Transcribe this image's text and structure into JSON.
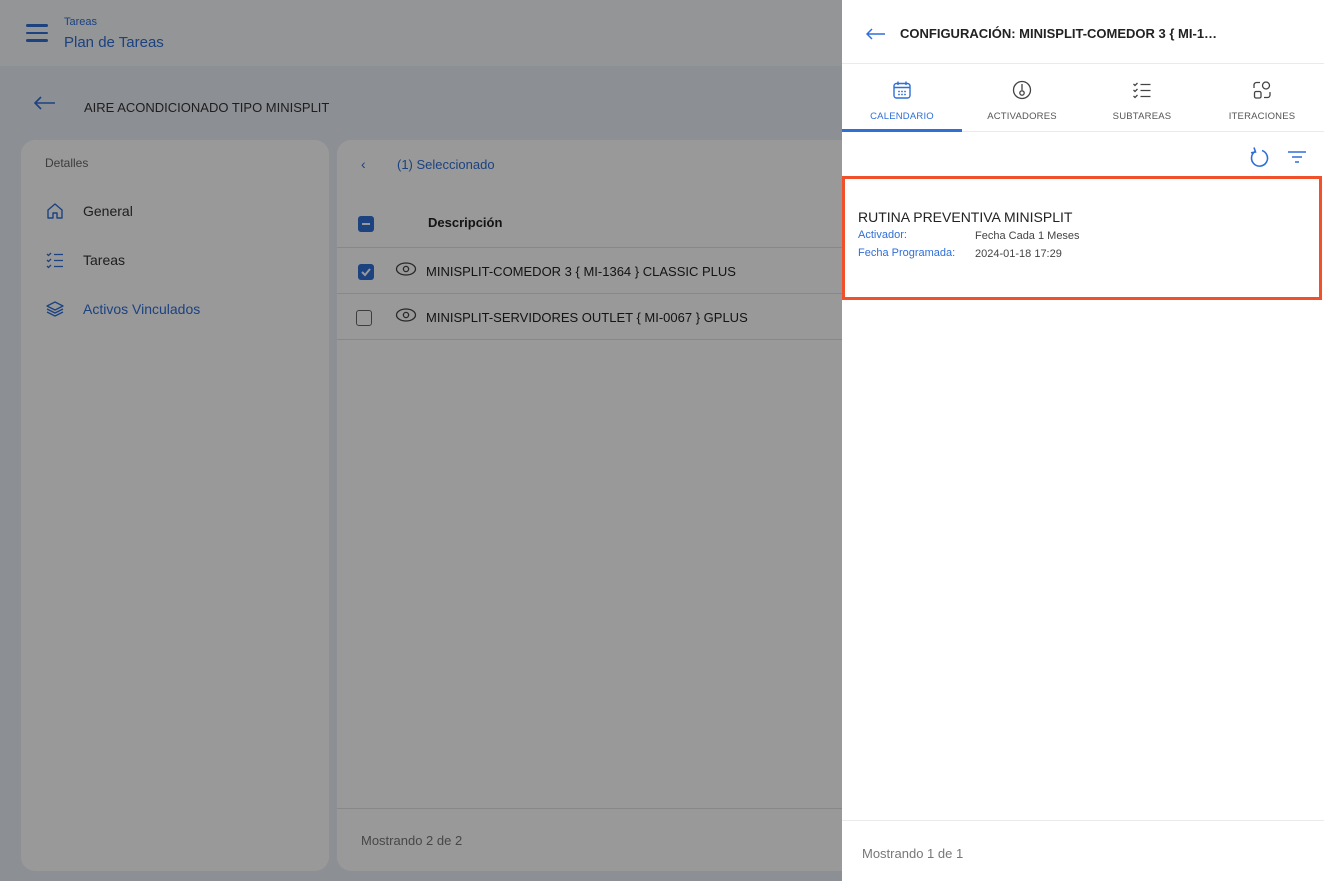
{
  "topbar": {
    "section": "Tareas",
    "title": "Plan de Tareas"
  },
  "subheader": {
    "title": "AIRE ACONDICIONADO TIPO MINISPLIT"
  },
  "sidebar": {
    "heading": "Detalles",
    "items": [
      {
        "label": "General",
        "icon": "home-icon"
      },
      {
        "label": "Tareas",
        "icon": "checklist-icon"
      },
      {
        "label": "Activos Vinculados",
        "icon": "layers-icon",
        "active": true
      }
    ]
  },
  "main": {
    "selection": "(1) Seleccionado",
    "column": "Descripción",
    "rows": [
      {
        "text": "MINISPLIT-COMEDOR 3 { MI-1364 } CLASSIC PLUS",
        "checked": true
      },
      {
        "text": "MINISPLIT-SERVIDORES OUTLET { MI-0067 } GPLUS",
        "checked": false
      }
    ],
    "footer": "Mostrando 2 de 2"
  },
  "drawer": {
    "title": "CONFIGURACIÓN: MINISPLIT-COMEDOR 3 { MI-1…",
    "tabs": [
      {
        "label": "CALENDARIO",
        "icon": "calendar-icon",
        "active": true
      },
      {
        "label": "ACTIVADORES",
        "icon": "trigger-icon"
      },
      {
        "label": "SUBTAREAS",
        "icon": "checklist-icon"
      },
      {
        "label": "ITERACIONES",
        "icon": "iterations-icon"
      }
    ],
    "card": {
      "title": "RUTINA PREVENTIVA MINISPLIT",
      "activator_label": "Activador:",
      "activator_value": "Fecha Cada 1 Meses",
      "date_label": "Fecha Programada:",
      "date_value": "2024-01-18 17:29"
    },
    "footer": "Mostrando 1 de 1"
  },
  "colors": {
    "accent": "#2f6fd6",
    "highlight": "#f0502a"
  }
}
